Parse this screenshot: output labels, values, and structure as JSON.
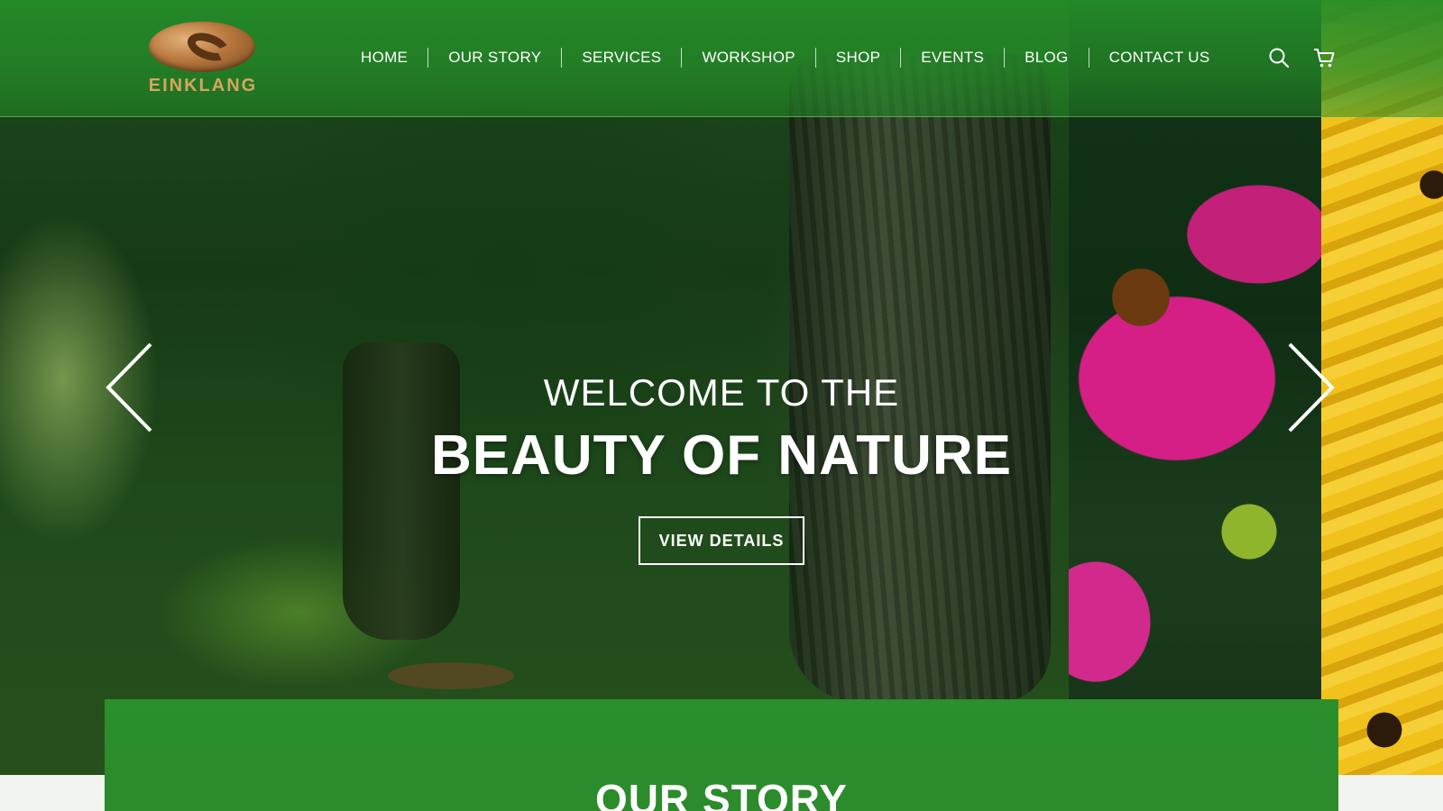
{
  "brand": {
    "name": "EINKLANG",
    "logo_icon": "swirl-logo-icon",
    "gold": "#c58a4a"
  },
  "nav": {
    "items": [
      {
        "label": "HOME"
      },
      {
        "label": "OUR STORY"
      },
      {
        "label": "SERVICES"
      },
      {
        "label": "WORKSHOP"
      },
      {
        "label": "SHOP"
      },
      {
        "label": "EVENTS"
      },
      {
        "label": "BLOG"
      },
      {
        "label": "CONTACT US"
      }
    ],
    "icons": [
      "search-icon",
      "cart-icon"
    ]
  },
  "hero": {
    "subtitle": "WELCOME TO THE",
    "title": "BEAUTY OF NATURE",
    "button_label": "VIEW DETAILS",
    "prev_icon": "chevron-left-icon",
    "next_icon": "chevron-right-icon"
  },
  "story": {
    "title": "OUR STORY"
  },
  "colors": {
    "primary_green": "#2a8f2c",
    "white": "#ffffff"
  }
}
